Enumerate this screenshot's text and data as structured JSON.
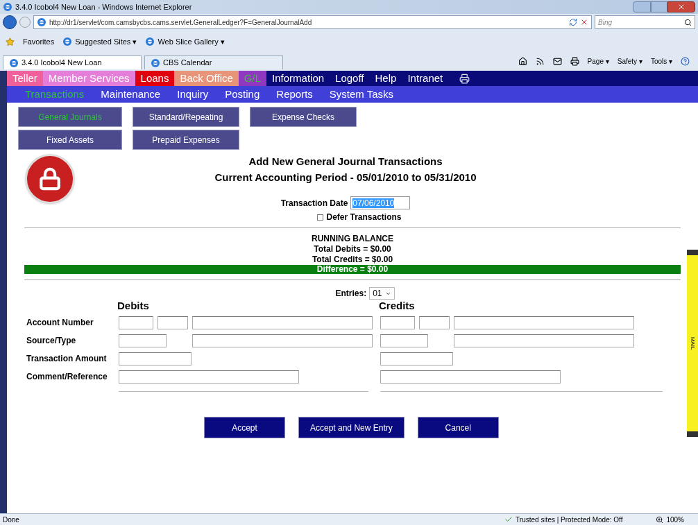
{
  "browser": {
    "title": "3.4.0 Icobol4 New Loan - Windows Internet Explorer",
    "address": "http://dr1/servlet/com.camsbycbs.cams.servlet.GeneralLedger?F=GeneralJournalAdd",
    "search_placeholder": "Bing",
    "favorites": "Favorites",
    "links": [
      "Suggested Sites ▾",
      "Web Slice Gallery ▾"
    ],
    "tabs": [
      {
        "label": "3.4.0 Icobol4 New Loan",
        "selected": true
      },
      {
        "label": "CBS Calendar",
        "selected": false
      }
    ],
    "menus": [
      "Page ▾",
      "Safety ▾",
      "Tools ▾"
    ]
  },
  "main_nav": [
    {
      "label": "Teller",
      "color": "#f0609a",
      "selected": false
    },
    {
      "label": "Member Services",
      "color": "#e47ed8",
      "selected": false
    },
    {
      "label": "Loans",
      "color": "#e00010",
      "selected": false
    },
    {
      "label": "Back Office",
      "color": "#e89478",
      "selected": false
    },
    {
      "label": "G/L",
      "color": "#9038c0",
      "selected": true
    },
    {
      "label": "Information",
      "color": "#0a0a78",
      "selected": false
    },
    {
      "label": "Logoff",
      "color": "#0a0a78",
      "selected": false
    },
    {
      "label": "Help",
      "color": "#0a0a78",
      "selected": false
    },
    {
      "label": "Intranet",
      "color": "#0a0a78",
      "selected": false
    }
  ],
  "sub_nav": [
    {
      "label": "Transactions",
      "selected": true
    },
    {
      "label": "Maintenance",
      "selected": false
    },
    {
      "label": "Inquiry",
      "selected": false
    },
    {
      "label": "Posting",
      "selected": false
    },
    {
      "label": "Reports",
      "selected": false
    },
    {
      "label": "System Tasks",
      "selected": false
    }
  ],
  "section_buttons": [
    {
      "label": "General Journals",
      "selected": true
    },
    {
      "label": "Standard/Repeating",
      "selected": false
    },
    {
      "label": "Expense Checks",
      "selected": false
    },
    {
      "label": "Fixed Assets",
      "selected": false
    },
    {
      "label": "Prepaid Expenses",
      "selected": false
    }
  ],
  "form": {
    "title": "Add New General Journal Transactions",
    "period": "Current Accounting Period - 05/01/2010 to 05/31/2010",
    "date_label": "Transaction Date",
    "date_value": "07/06/2010",
    "defer": {
      "label": "Defer Transactions",
      "checked": false
    },
    "balance": {
      "heading": "RUNNING BALANCE",
      "debits": "Total Debits = $0.00",
      "credits": "Total Credits = $0.00",
      "difference": "Difference = $0.00"
    },
    "entries": {
      "label": "Entries:",
      "value": "01"
    },
    "debits_heading": "Debits",
    "credits_heading": "Credits",
    "row_labels": [
      "Account Number",
      "Source/Type",
      "Transaction Amount",
      "Comment/Reference"
    ],
    "buttons": [
      "Accept",
      "Accept and New Entry",
      "Cancel"
    ]
  },
  "side_tab": "MAIL",
  "status_bar": {
    "text": "Done",
    "zone": "Trusted sites | Protected Mode: Off",
    "zoom": "100%"
  }
}
